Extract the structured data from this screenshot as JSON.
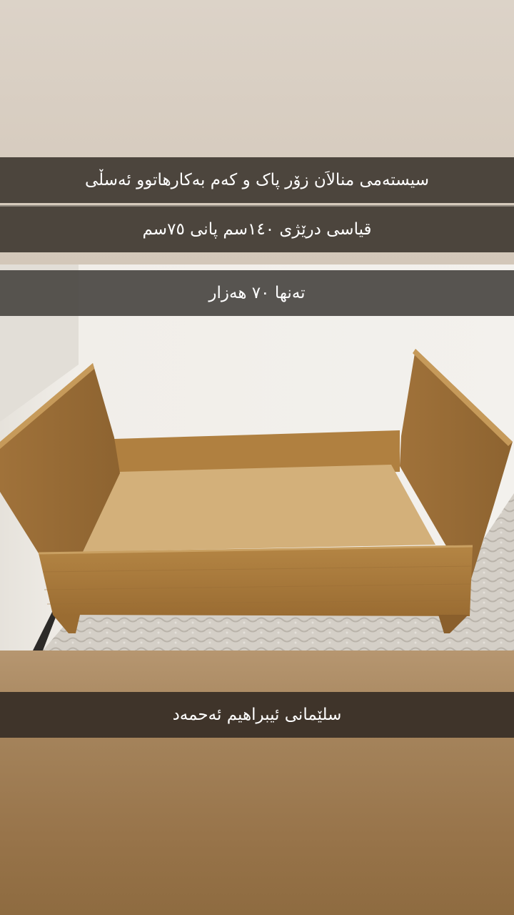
{
  "story": {
    "caption_line1": "سیستەمی منالاَن زۆر پاک و کەم بەکارهاتوو  ئەسڵی",
    "caption_line2": "قیاسی درێژی ١٤٠سم پانی ٧٥سم",
    "price": "تەنها ٧٠ هەزار",
    "location": "سلێمانی ئیبراهیم ئەحمەد"
  },
  "photo": {
    "subject": "wooden-toddler-bed",
    "colors": {
      "wall": "#ece9e3",
      "wood": "#a87a3c",
      "mattress_board": "#d2b07c",
      "carpet": "#cfcac2"
    }
  }
}
